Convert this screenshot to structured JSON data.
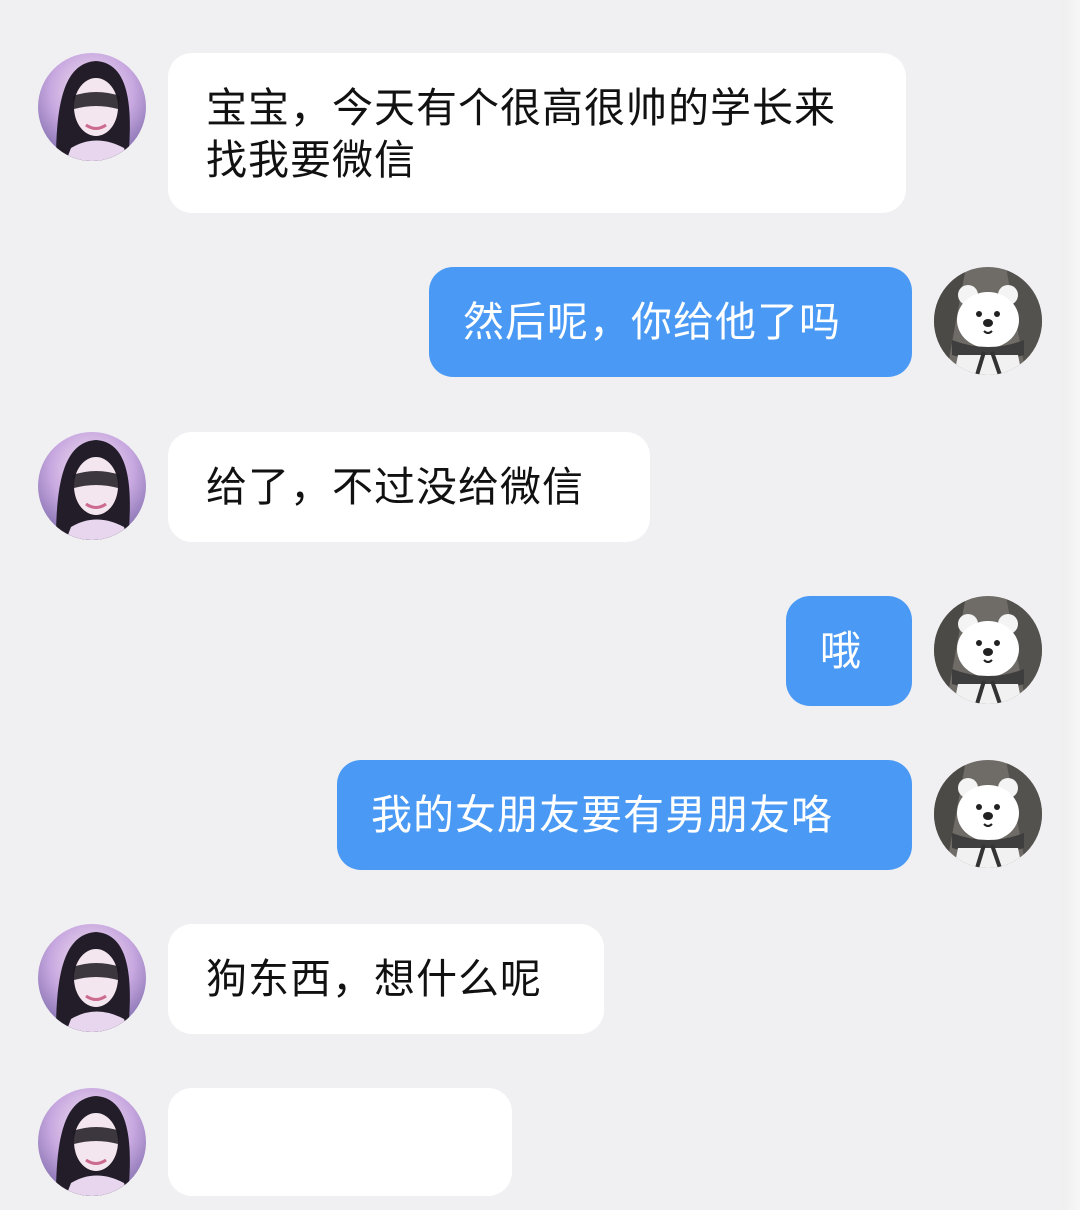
{
  "messages": [
    {
      "sender": "girl",
      "text": "宝宝，今天有个很高很帅的学长来找我要微信"
    },
    {
      "sender": "me",
      "text": "然后呢，你给他了吗"
    },
    {
      "sender": "girl",
      "text": "给了，不过没给微信"
    },
    {
      "sender": "me",
      "text": "哦"
    },
    {
      "sender": "me",
      "text": "我的女朋友要有男朋友咯"
    },
    {
      "sender": "girl",
      "text": "狗东西，想什么呢"
    },
    {
      "sender": "girl",
      "text": ""
    }
  ],
  "colors": {
    "background": "#f0f0f2",
    "incoming_bubble": "#ffffff",
    "outgoing_bubble": "#4a9af5"
  },
  "icons": {
    "girl_avatar": "girl-avatar-icon",
    "bear_avatar": "bear-avatar-icon"
  }
}
